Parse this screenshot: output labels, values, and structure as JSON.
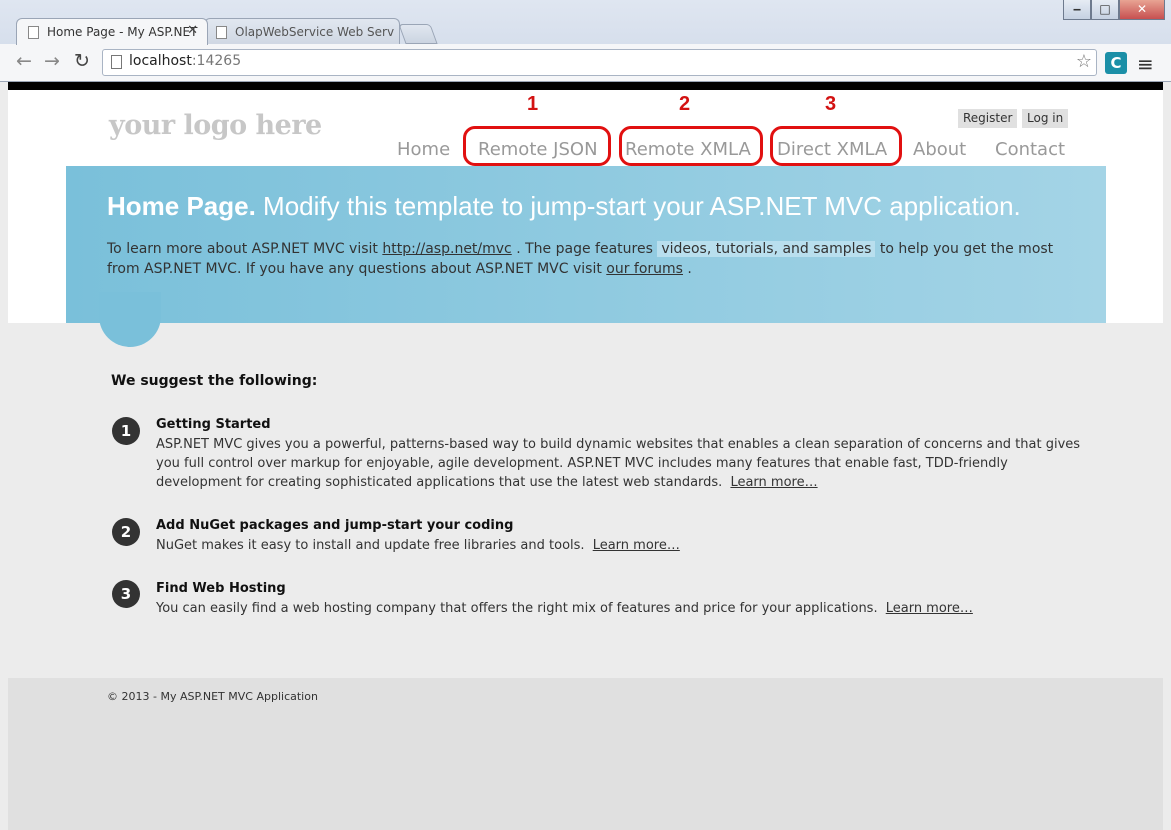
{
  "browser": {
    "tabs": [
      {
        "title": "Home Page - My ASP.NET",
        "active": true
      },
      {
        "title": "OlapWebService Web Serv",
        "active": false
      }
    ],
    "url_host": "localhost",
    "url_port": ":14265",
    "window_controls": {
      "minimize": "‒",
      "maximize": "□",
      "close": "✕"
    },
    "nav_icons": {
      "back": "←",
      "forward": "→",
      "reload": "↻",
      "star": "☆",
      "menu": "≡"
    }
  },
  "site": {
    "logo": "your logo here",
    "auth": {
      "register": "Register",
      "login": "Log in"
    },
    "nav": [
      "Home",
      "Remote JSON",
      "Remote XMLA",
      "Direct XMLA",
      "About",
      "Contact"
    ],
    "annotations": [
      "1",
      "2",
      "3"
    ],
    "annotation_color": "#e11010"
  },
  "featured": {
    "title_bold": "Home Page.",
    "title_rest": " Modify this template to jump-start your ASP.NET MVC application.",
    "t1": "To learn more about ASP.NET MVC visit ",
    "link1": "http://asp.net/mvc",
    "t2": " . The page features ",
    "highlight": "videos, tutorials, and samples",
    "t3": " to help you get the most from ASP.NET MVC. If you have any questions about ASP.NET MVC visit ",
    "link2": "our forums",
    "t4": " ."
  },
  "main": {
    "heading": "We suggest the following:",
    "steps": [
      {
        "num": "1",
        "title": "Getting Started",
        "text": "ASP.NET MVC gives you a powerful, patterns-based way to build dynamic websites that enables a clean separation of concerns and that gives you full control over markup for enjoyable, agile development. ASP.NET MVC includes many features that enable fast, TDD-friendly development for creating sophisticated applications that use the latest web standards. ",
        "link": "Learn more…"
      },
      {
        "num": "2",
        "title": "Add NuGet packages and jump-start your coding",
        "text": "NuGet makes it easy to install and update free libraries and tools. ",
        "link": "Learn more…"
      },
      {
        "num": "3",
        "title": "Find Web Hosting",
        "text": "You can easily find a web hosting company that offers the right mix of features and price for your applications. ",
        "link": "Learn more…"
      }
    ]
  },
  "footer": {
    "copyright": "© 2013 - My ASP.NET MVC Application"
  }
}
